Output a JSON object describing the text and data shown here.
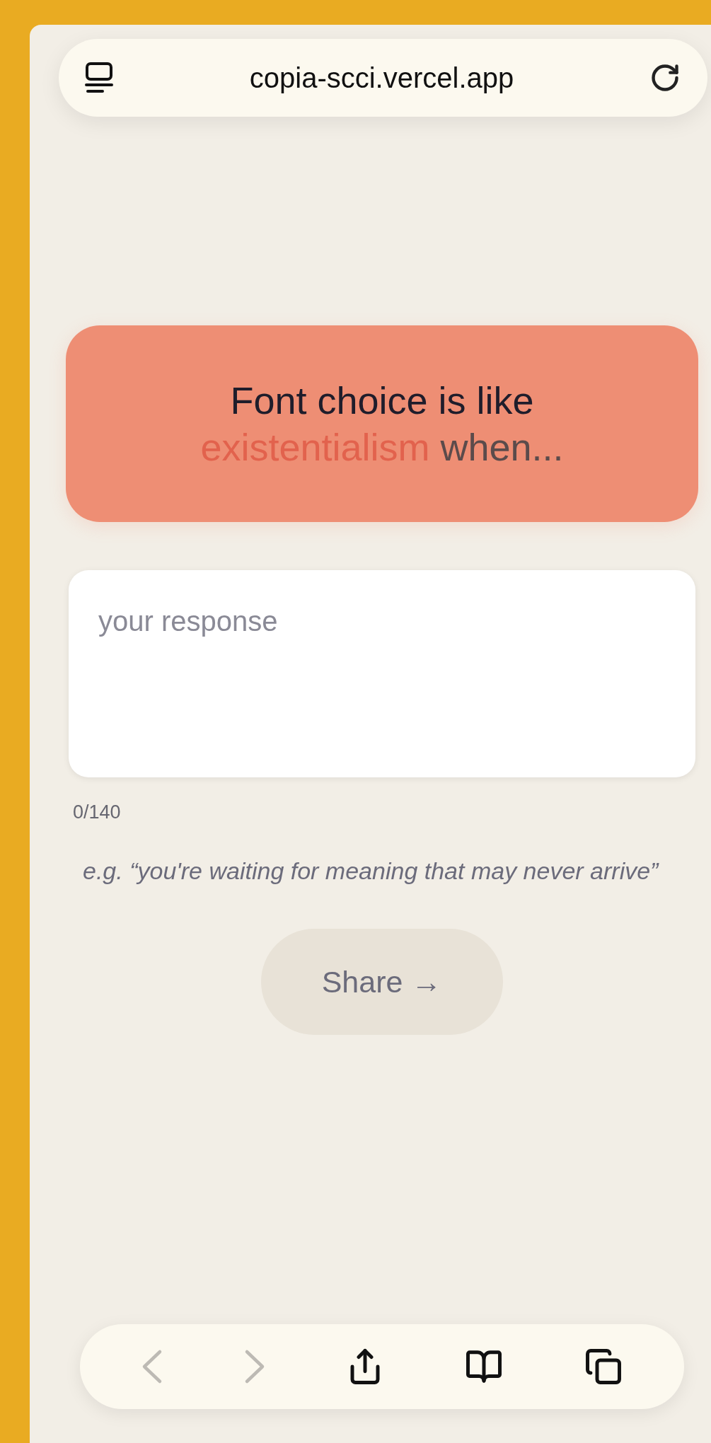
{
  "address_bar": {
    "url": "copia-scci.vercel.app"
  },
  "prompt": {
    "line_1": "Font choice is like",
    "highlight": "existentialism",
    "tail": "when..."
  },
  "response": {
    "placeholder": "your response",
    "counter": "0/140"
  },
  "hint": "e.g. “you're waiting for meaning that may never arrive”",
  "share_button": "Share →",
  "toolbar": [
    {
      "kind": "back",
      "disabled": true
    },
    {
      "kind": "forward",
      "disabled": true
    },
    {
      "kind": "share",
      "disabled": false
    },
    {
      "kind": "bookmarks",
      "disabled": false
    },
    {
      "kind": "tabs",
      "disabled": false
    }
  ]
}
